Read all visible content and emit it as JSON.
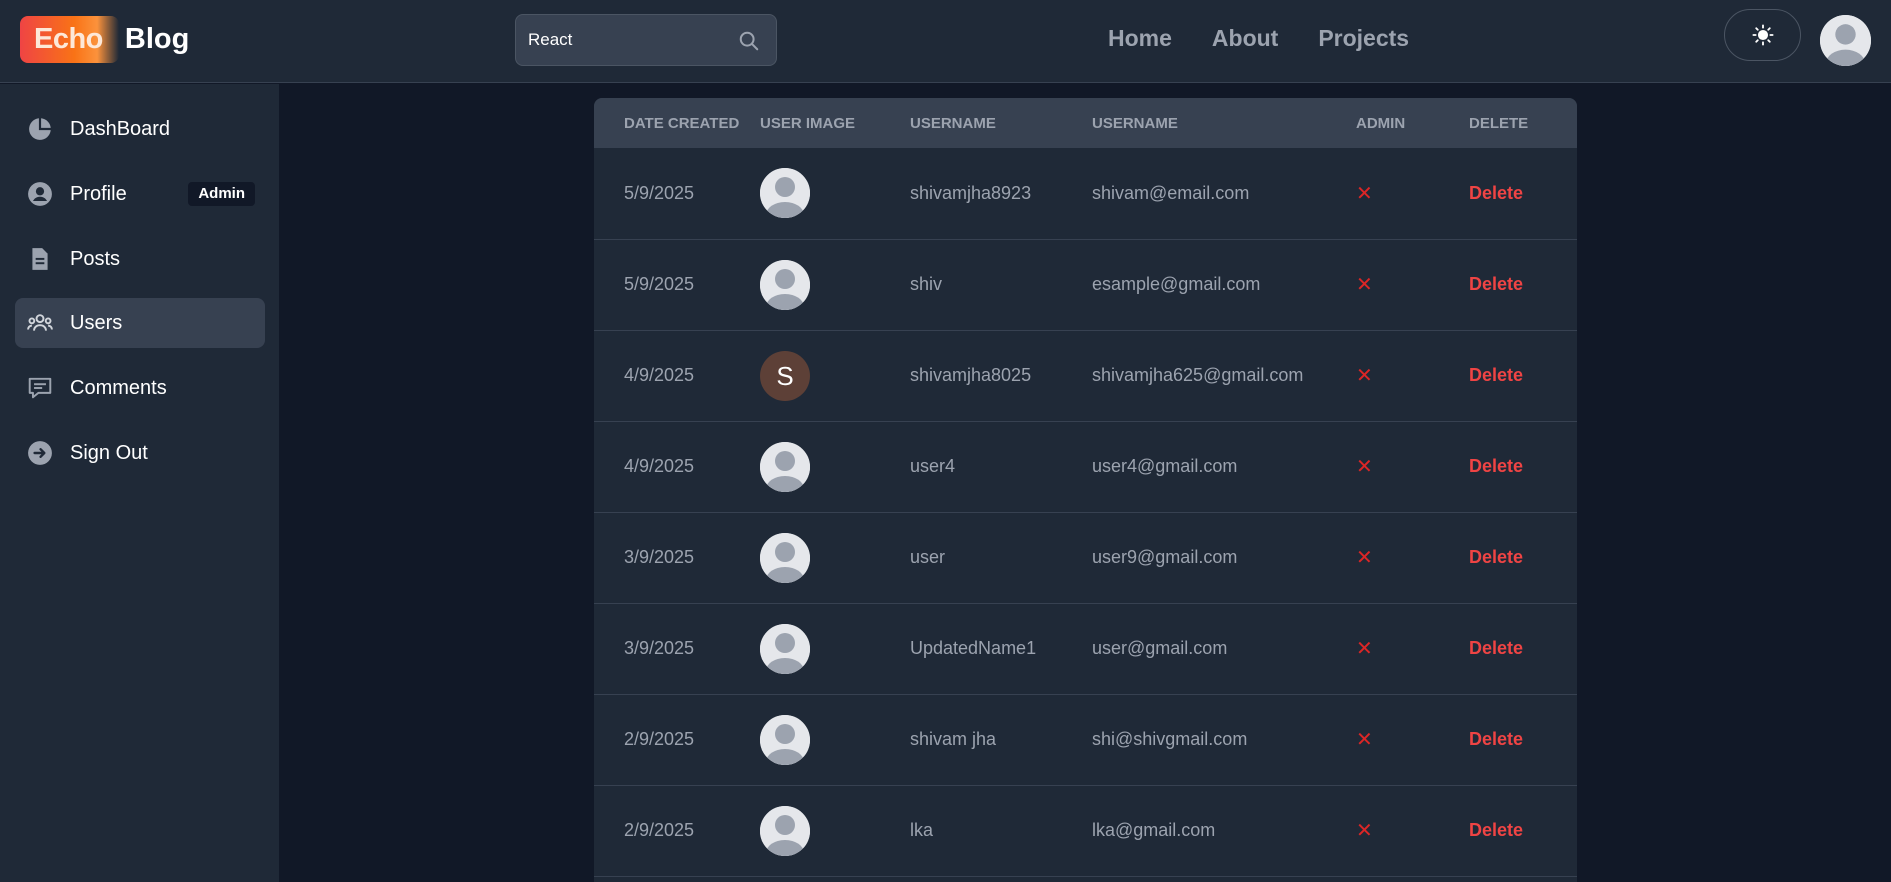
{
  "header": {
    "brand_part1": "Echo",
    "brand_part2": "Blog",
    "search": {
      "value": "React",
      "icon": "search-icon"
    },
    "nav": [
      {
        "label": "Home"
      },
      {
        "label": "About"
      },
      {
        "label": "Projects"
      }
    ],
    "theme_icon": "sun-icon",
    "avatar_icon": "user-avatar-icon"
  },
  "sidebar": {
    "items": [
      {
        "label": "DashBoard",
        "icon": "pie-chart-icon"
      },
      {
        "label": "Profile",
        "icon": "user-circle-icon",
        "badge": "Admin"
      },
      {
        "label": "Posts",
        "icon": "document-icon"
      },
      {
        "label": "Users",
        "icon": "users-group-icon",
        "active": true
      },
      {
        "label": "Comments",
        "icon": "comment-icon"
      },
      {
        "label": "Sign Out",
        "icon": "arrow-right-circle-icon"
      }
    ]
  },
  "table": {
    "headers": [
      "Date Created",
      "User Image",
      "Username",
      "Username",
      "Admin",
      "Delete"
    ],
    "rows": [
      {
        "date": "5/9/2025",
        "image": "default",
        "username": "shivamjha8923",
        "email": "shivam@email.com",
        "admin": "✕",
        "delete": "Delete"
      },
      {
        "date": "5/9/2025",
        "image": "default",
        "username": "shiv",
        "email": "esample@gmail.com",
        "admin": "✕",
        "delete": "Delete"
      },
      {
        "date": "4/9/2025",
        "image": "letter",
        "letter": "S",
        "username": "shivamjha8025",
        "email": "shivamjha625@gmail.com",
        "admin": "✕",
        "delete": "Delete"
      },
      {
        "date": "4/9/2025",
        "image": "default",
        "username": "user4",
        "email": "user4@gmail.com",
        "admin": "✕",
        "delete": "Delete"
      },
      {
        "date": "3/9/2025",
        "image": "default",
        "username": "user",
        "email": "user9@gmail.com",
        "admin": "✕",
        "delete": "Delete"
      },
      {
        "date": "3/9/2025",
        "image": "default",
        "username": "UpdatedName1",
        "email": "user@gmail.com",
        "admin": "✕",
        "delete": "Delete"
      },
      {
        "date": "2/9/2025",
        "image": "default",
        "username": "shivam jha",
        "email": "shi@shivgmail.com",
        "admin": "✕",
        "delete": "Delete"
      },
      {
        "date": "2/9/2025",
        "image": "default",
        "username": "lka",
        "email": "lka@gmail.com",
        "admin": "✕",
        "delete": "Delete"
      }
    ]
  },
  "colors": {
    "background": "#111827",
    "panel": "#1f2937",
    "header_row": "#374151",
    "delete_red": "#ef4444",
    "admin_x_red": "#dc2626",
    "brand_gradient_start": "#ef4444",
    "brand_gradient_end": "#f97316"
  }
}
